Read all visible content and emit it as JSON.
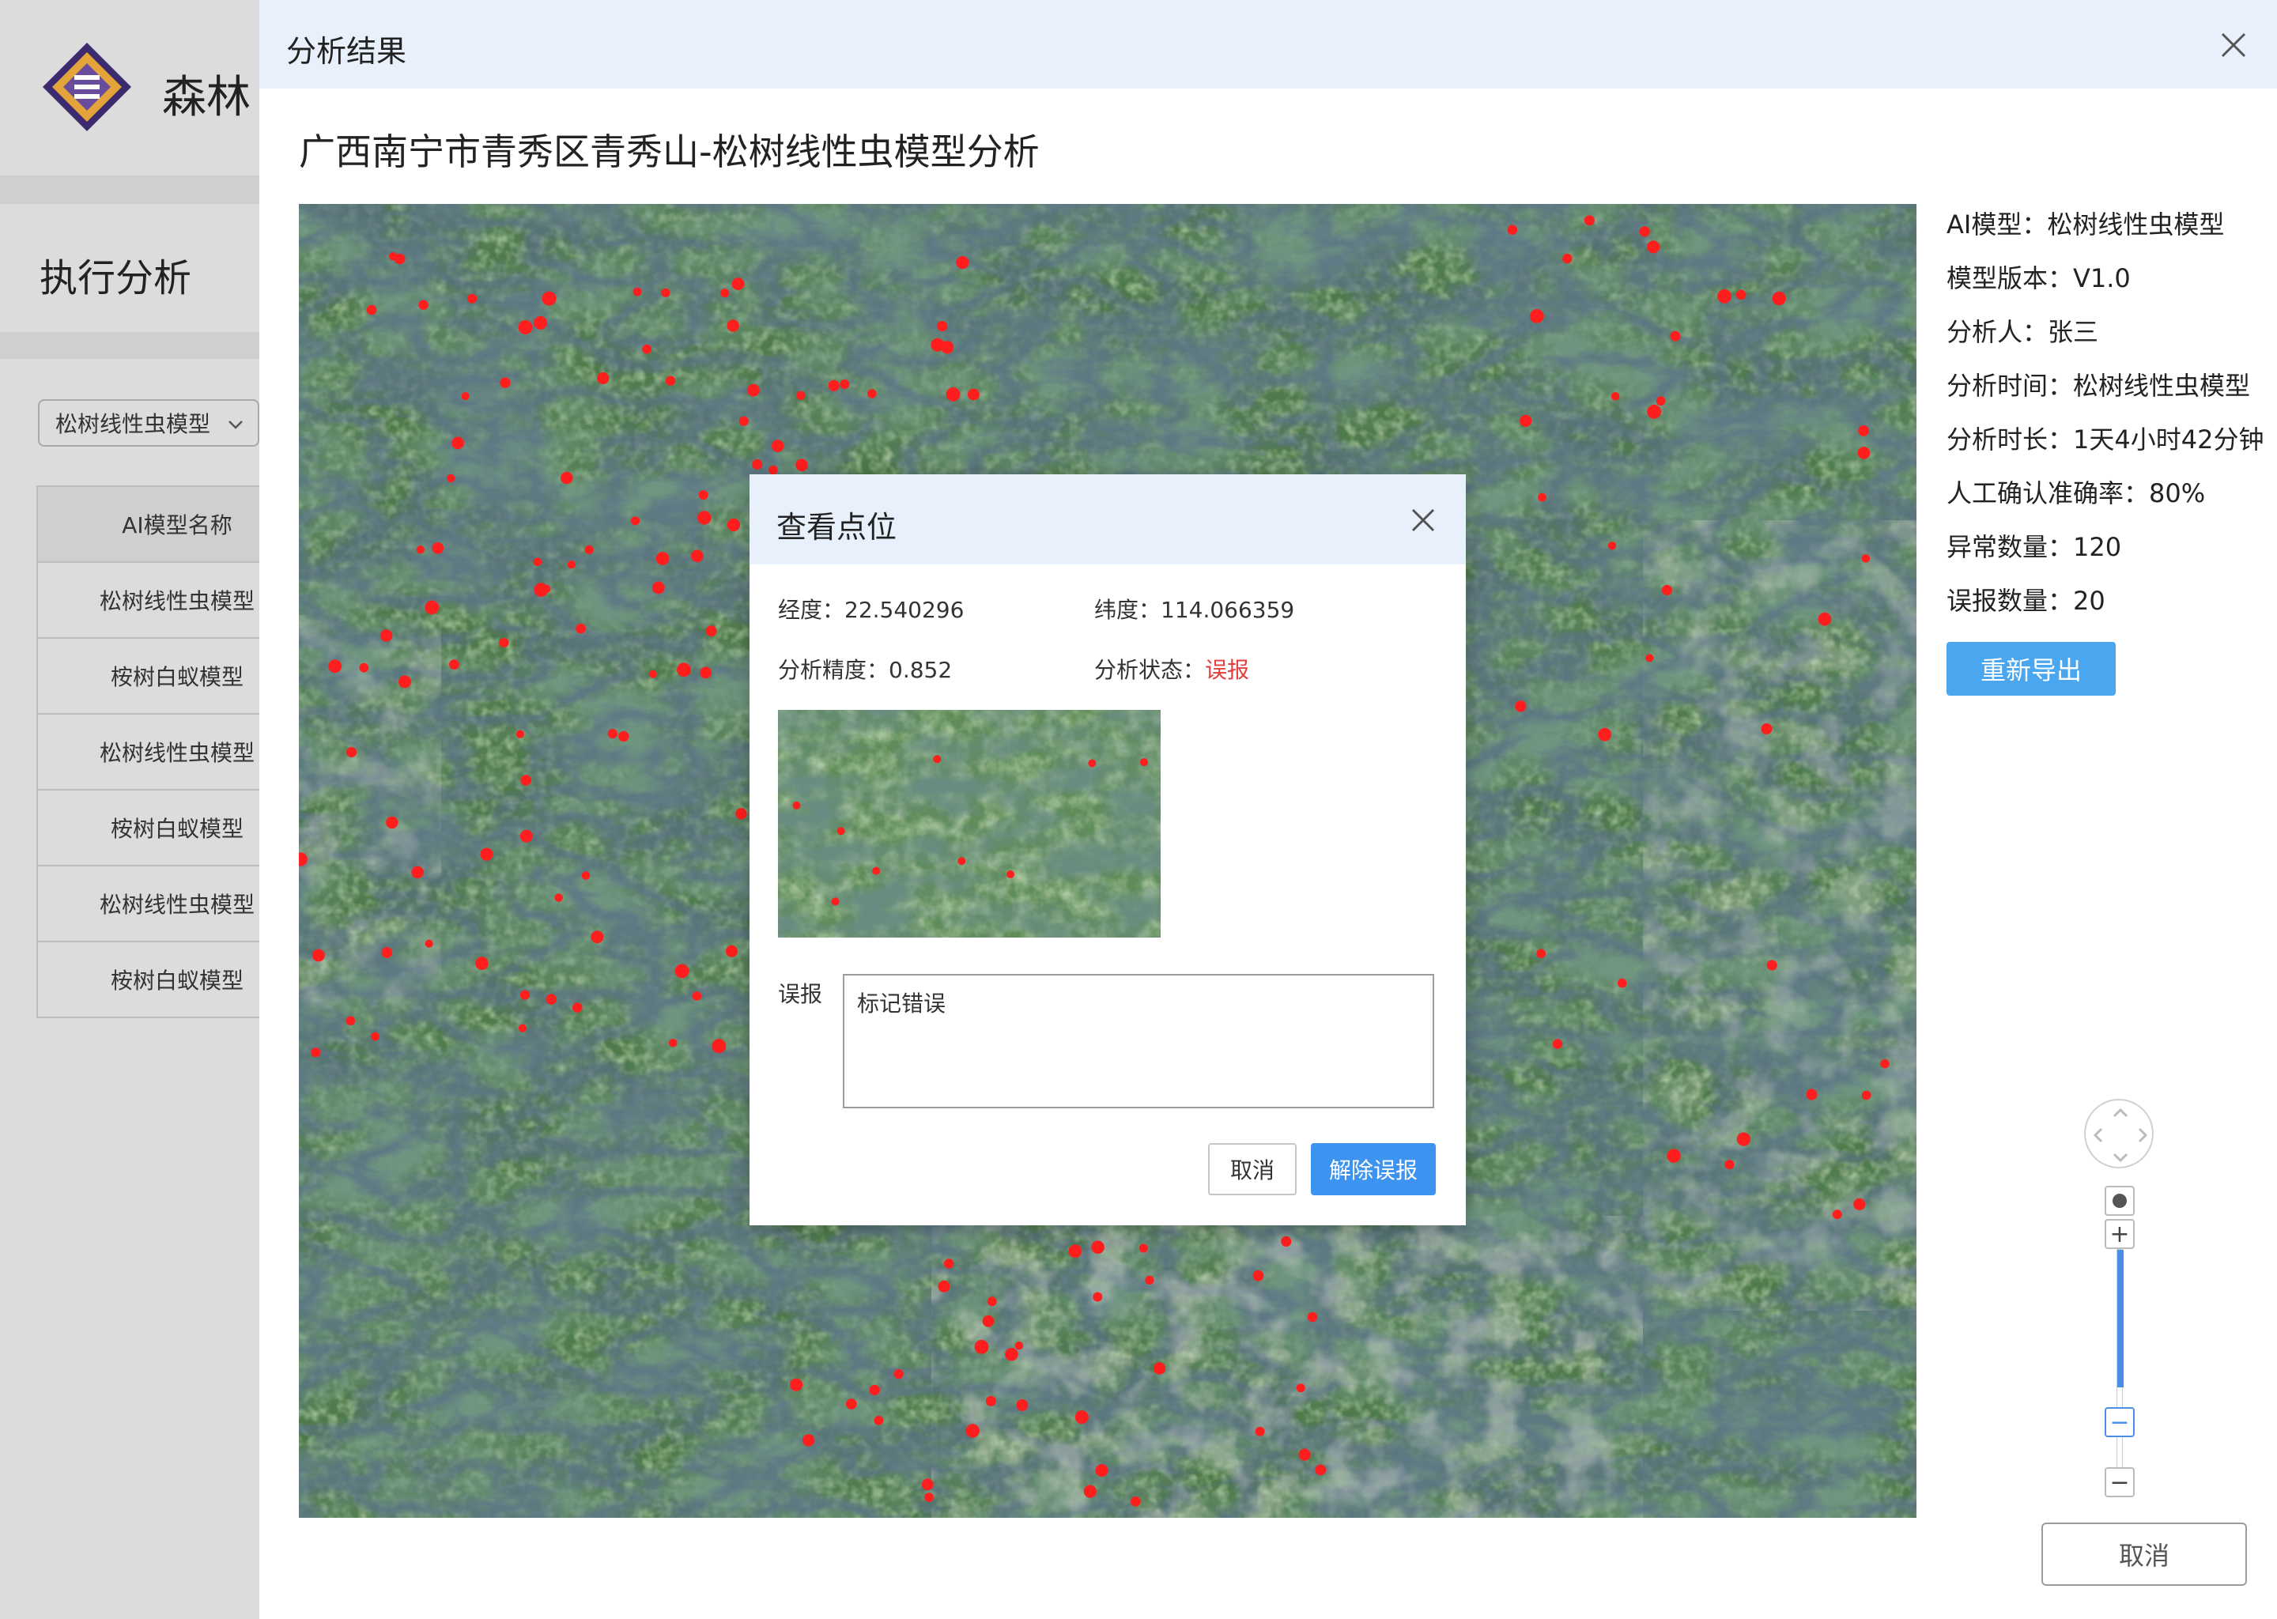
{
  "background": {
    "brand": "森林",
    "section_title": "执行分析",
    "model_select": "松树线性虫模型",
    "table_header": "AI模型名称",
    "table_rows": [
      "松树线性虫模型",
      "桉树白蚁模型",
      "松树线性虫模型",
      "桉树白蚁模型",
      "松树线性虫模型",
      "桉树白蚁模型"
    ]
  },
  "modal": {
    "title": "分析结果",
    "page_title": "广西南宁市青秀区青秀山-松树线性虫模型分析",
    "export_label": "重新导出",
    "cancel_label": "取消"
  },
  "info": {
    "ai_model": "AI模型：松树线性虫模型",
    "model_version": "模型版本：V1.0",
    "analyst": "分析人：张三",
    "analysis_time": "分析时间：松树线性虫模型",
    "duration": "分析时长：1天4小时42分钟",
    "accuracy": "人工确认准确率：80%",
    "anomaly_count": "异常数量：120",
    "false_count": "误报数量：20"
  },
  "map_controls": {
    "zoom_in": "+",
    "zoom_out": "−",
    "zoom_level_fraction": 0.6
  },
  "dialog": {
    "title": "查看点位",
    "longitude_label": "经度：",
    "longitude": "22.540296",
    "latitude_label": "纬度：",
    "latitude": "114.066359",
    "precision_label": "分析精度：",
    "precision": "0.852",
    "status_label": "分析状态：",
    "status": "误报",
    "remark_label": "误报",
    "remark_value": "标记错误",
    "cancel_label": "取消",
    "confirm_label": "解除误报"
  },
  "colors": {
    "accent": "#3d93f0",
    "export": "#4aa6ee",
    "status_false": "#e53c3c",
    "header_bg": "#e8f1fb",
    "marker": "#ff1e1e"
  }
}
